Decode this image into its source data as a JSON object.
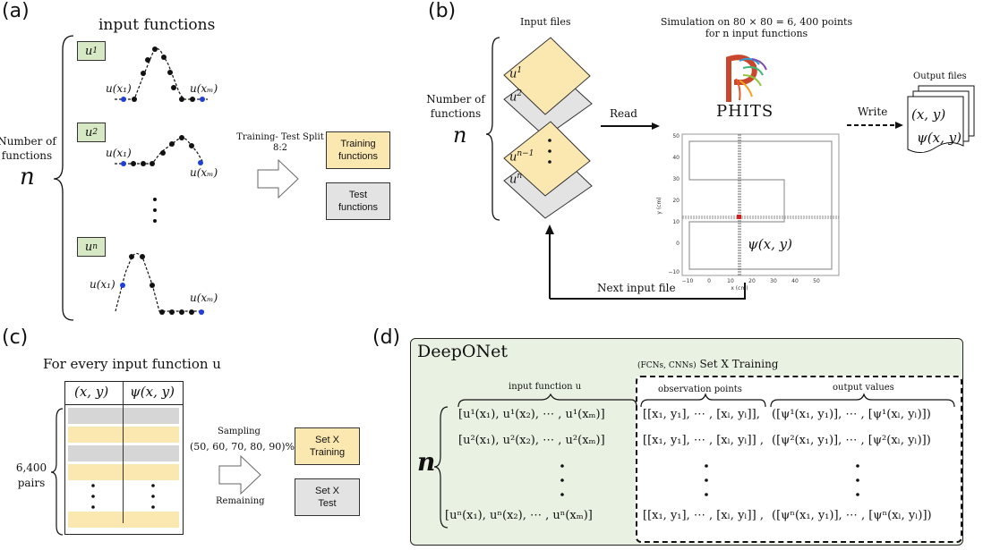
{
  "panels": {
    "a": {
      "label": "(a)",
      "title": "input functions",
      "side_label": "Number of\nfunctions",
      "n_symbol": "n",
      "functions": [
        {
          "name": "u1",
          "base": "u",
          "sup": "1"
        },
        {
          "name": "u2",
          "base": "u",
          "sup": "2"
        },
        {
          "name": "un",
          "base": "u",
          "sup": "n"
        }
      ],
      "point_labels": {
        "first": "u(x₁)",
        "last": "u(xₘ)"
      },
      "vdots": "⋮",
      "split_label": "Training- Test Split",
      "split_ratio": "8:2",
      "train_box": "Training\nfunctions",
      "test_box": "Test\nfunctions"
    },
    "b": {
      "label": "(b)",
      "input_files_title": "Input files",
      "side_label": "Number of\nfunctions",
      "n_symbol": "n",
      "files": [
        {
          "name": "u1",
          "base": "u",
          "sup": "1",
          "color": "yellow"
        },
        {
          "name": "u2",
          "base": "u",
          "sup": "2",
          "color": "gray"
        },
        {
          "name": "un-1",
          "base": "u",
          "sup": "n−1",
          "color": "yellow"
        },
        {
          "name": "un",
          "base": "u",
          "sup": "n",
          "color": "gray"
        }
      ],
      "simulation_title_line1": "Simulation on 80 × 80 = 6, 400 points",
      "simulation_title_line2": "for n input functions",
      "software": "PHITS",
      "read_label": "Read",
      "write_label": "Write",
      "next_label": "Next input file",
      "output_files_title": "Output files",
      "output_line1": "(x, y)",
      "output_line2": "ψ(x, y)",
      "plot": {
        "xlabel": "x (cm)",
        "ylabel": "y (cm)",
        "xticks": [
          "−10",
          "0",
          "10",
          "20",
          "30",
          "40",
          "50"
        ],
        "yticks": [
          "−10",
          "0",
          "10",
          "20",
          "30",
          "40",
          "50"
        ],
        "annotation": "ψ(x, y)"
      }
    },
    "c": {
      "label": "(c)",
      "title": "For every input function u",
      "col1": "(x, y)",
      "col2": "ψ(x, y)",
      "rows_label": "6,400\npairs",
      "sampling_label": "Sampling",
      "sampling_values": "(50, 60, 70, 80, 90)%",
      "remaining_label": "Remaining",
      "train_box": "Set X\nTraining",
      "test_box": "Set X\nTest",
      "vdots": "⋮"
    },
    "d": {
      "label": "(d)",
      "title": "DeepONet",
      "subtitle_small": "(FCNs, CNNs)",
      "subtitle": "Set X Training",
      "n_symbol": "n",
      "headers": {
        "input": "input function u",
        "obs": "observation points",
        "out": "output values"
      },
      "rows": [
        {
          "input": "[u¹(x₁), u¹(x₂), ⋯ , u¹(xₘ)]",
          "obs": "[[x₁, y₁], ⋯ , [xₗ, yₗ]],",
          "out": "([ψ¹(x₁, y₁)], ⋯ , [ψ¹(xₗ, yₗ)])"
        },
        {
          "input": "[u²(x₁), u²(x₂), ⋯ , u²(xₘ)]",
          "obs": "[[x₁, y₁], ⋯ , [xₗ, yₗ]] ,",
          "out": "([ψ²(x₁, y₁)], ⋯ , [ψ²(xₗ, yₗ)])"
        },
        {
          "input": "[uⁿ(x₁), uⁿ(x₂), ⋯ , uⁿ(xₘ)]",
          "obs": "[[x₁, y₁], ⋯ , [xₗ, yₗ]] ,",
          "out": "([ψⁿ(x₁, y₁)], ⋯ , [ψⁿ(xₗ, yₗ)])"
        }
      ],
      "vdots": "⋮"
    }
  },
  "colors": {
    "yellow": "#fbe7b0",
    "gray": "#e3e3e3",
    "green_label": "#d7e9c4",
    "deep_bg": "#e9f2e2",
    "blue_point": "#1f3fd6",
    "red_point": "#d42020"
  }
}
